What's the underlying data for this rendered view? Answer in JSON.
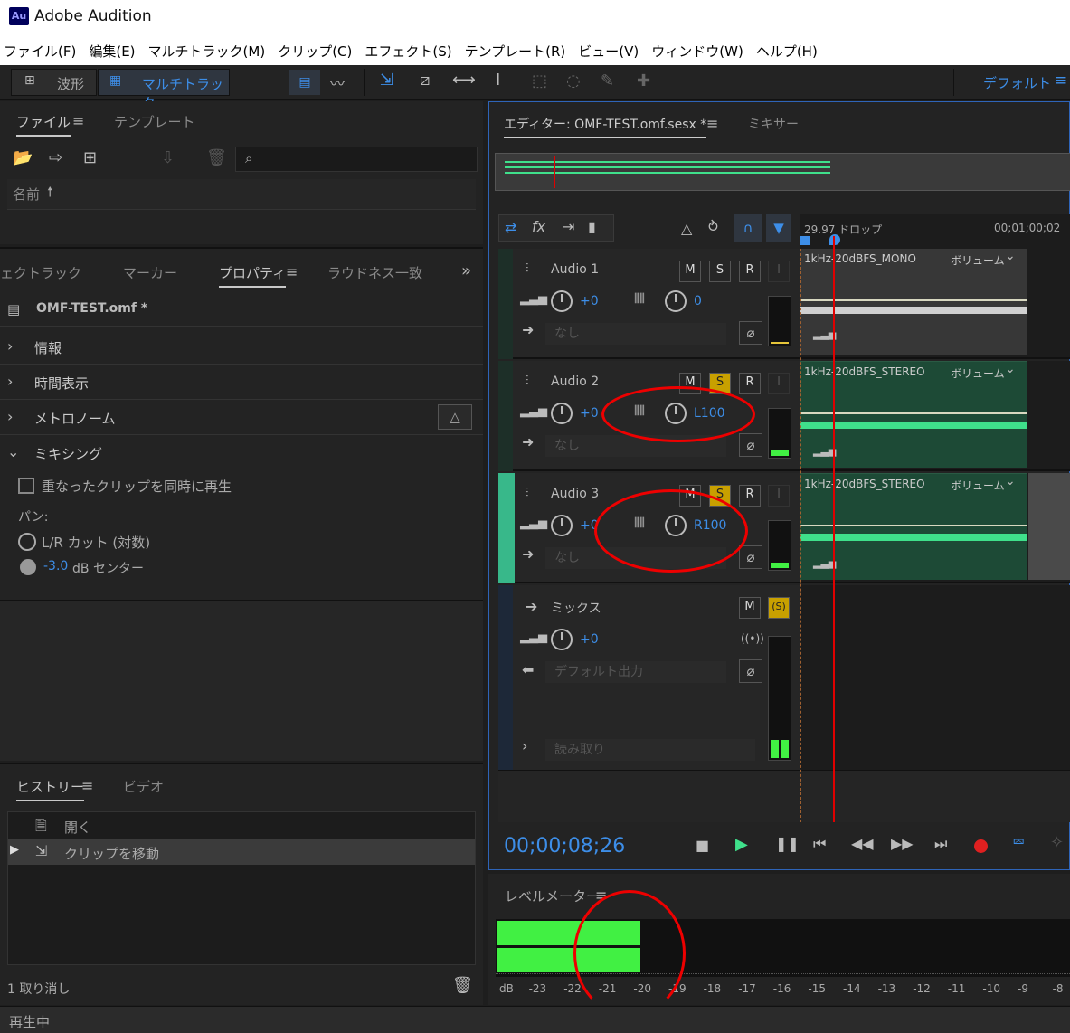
{
  "app": {
    "logo": "Au",
    "title": "Adobe Audition"
  },
  "menu": [
    "ファイル(F)",
    "編集(E)",
    "マルチトラック(M)",
    "クリップ(C)",
    "エフェクト(S)",
    "テンプレート(R)",
    "ビュー(V)",
    "ウィンドウ(W)",
    "ヘルプ(H)"
  ],
  "toolbar": {
    "waveform_label": "波形",
    "multitrack_label": "マルチトラック",
    "workspace_label": "デフォルト"
  },
  "files_panel": {
    "tab_files": "ファイル",
    "tab_templates": "テンプレート",
    "column_name": "名前",
    "sort_icon": "arrow-up-icon"
  },
  "props_panel": {
    "tabs": [
      "ェクトラック",
      "マーカー",
      "プロパティ",
      "ラウドネス一致"
    ],
    "file_name": "OMF-TEST.omf *",
    "sections": [
      "情報",
      "時間表示",
      "メトロノーム",
      "ミキシング"
    ],
    "overlap_label": "重なったクリップを同時に再生",
    "pan_label": "パン:",
    "pan_option1": "L/R カット (対数)",
    "pan_option2_value": "-3.0",
    "pan_option2_label": "dB センター"
  },
  "history_panel": {
    "tab_history": "ヒストリー",
    "tab_video": "ビデオ",
    "items": [
      "開く",
      "クリップを移動"
    ],
    "undo_count": "1 取り消し"
  },
  "status": {
    "text": "再生中"
  },
  "editor": {
    "tab_editor": "エディター: OMF-TEST.omf.sesx *",
    "tab_mixer": "ミキサー",
    "ruler_fps": "29.97 ドロップ",
    "ruler_time": "00;01;00;02",
    "timecode": "00;00;08;26"
  },
  "tracks": [
    {
      "name": "Audio 1",
      "volume": "+0",
      "pan": "0",
      "input": "なし",
      "clip": "1kHz-20dBFS_MONO",
      "clip_param": "ボリューム",
      "m": "M",
      "s": "S",
      "r": "R",
      "i": "I"
    },
    {
      "name": "Audio 2",
      "volume": "+0",
      "pan": "L100",
      "input": "なし",
      "clip": "1kHz-20dBFS_STEREO",
      "clip_param": "ボリューム",
      "m": "M",
      "s": "S",
      "r": "R",
      "i": "I"
    },
    {
      "name": "Audio 3",
      "volume": "+0",
      "pan": "R100",
      "input": "なし",
      "clip": "1kHz-20dBFS_STEREO",
      "clip_param": "ボリューム",
      "m": "M",
      "s": "S",
      "r": "R",
      "i": "I"
    }
  ],
  "mix_track": {
    "name": "ミックス",
    "volume": "+0",
    "output": "デフォルト出力",
    "automation": "読み取り",
    "m": "M",
    "s": "(S)"
  },
  "level_meter": {
    "title": "レベルメーター",
    "scale": [
      "dB",
      "-23",
      "-22",
      "-21",
      "-20",
      "-19",
      "-18",
      "-17",
      "-16",
      "-15",
      "-14",
      "-13",
      "-12",
      "-11",
      "-10",
      "-9",
      "-8"
    ],
    "level_db": -20
  },
  "colors": {
    "accent": "#3d8ee8",
    "green": "#41f043",
    "playhead": "#e00000",
    "solo": "#c8a000"
  }
}
